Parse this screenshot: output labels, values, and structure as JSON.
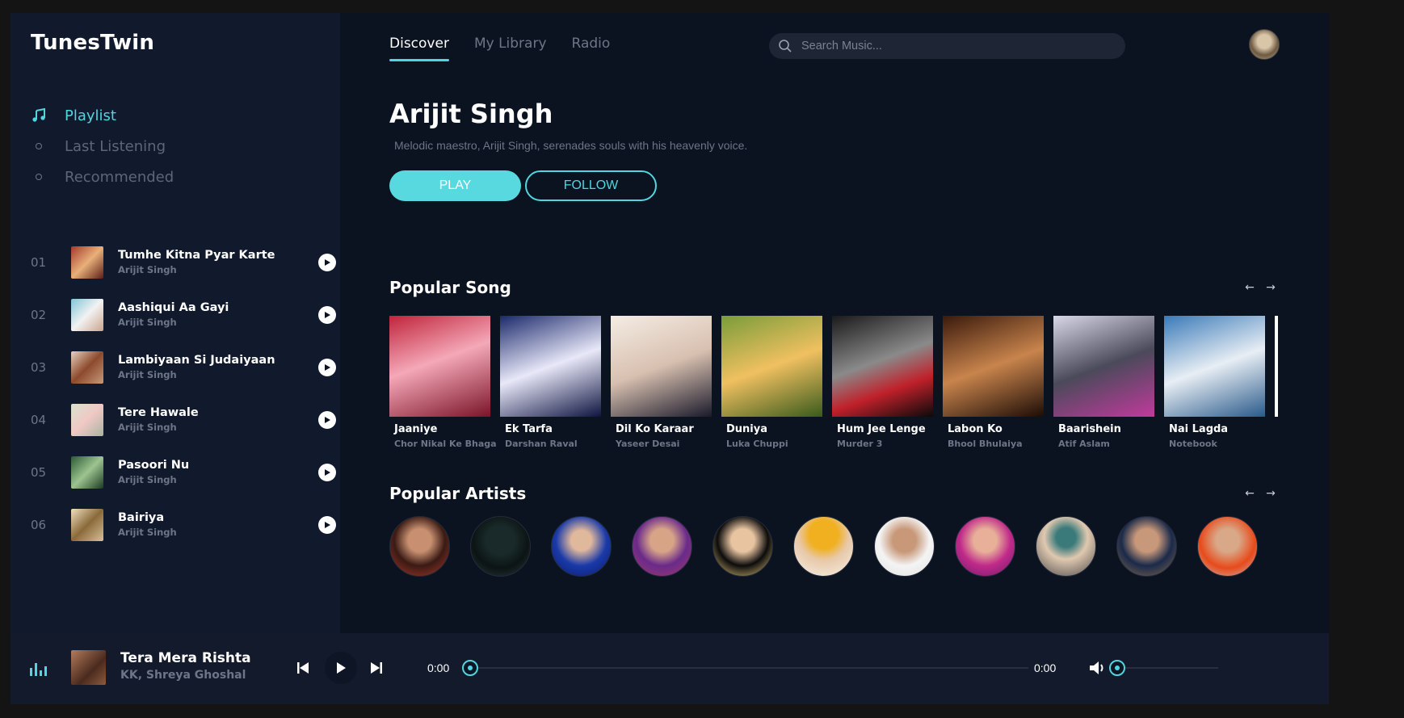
{
  "app": {
    "name": "TunesTwin"
  },
  "sidebar": {
    "nav": [
      {
        "label": "Playlist",
        "icon": "music-note-icon",
        "active": true
      },
      {
        "label": "Last Listening",
        "icon": "circle-bullet-icon",
        "active": false
      },
      {
        "label": "Recommended",
        "icon": "circle-bullet-icon",
        "active": false
      }
    ],
    "playlist": [
      {
        "num": "01",
        "title": "Tumhe Kitna Pyar Karte",
        "artist": "Arijit Singh",
        "thumb": "linear-gradient(135deg,#a4382c,#e8b07a 50%,#5c1e18)"
      },
      {
        "num": "02",
        "title": "Aashiqui Aa Gayi",
        "artist": "Arijit Singh",
        "thumb": "linear-gradient(135deg,#7fc6d8,#f2f2f2 50%,#caa48c)"
      },
      {
        "num": "03",
        "title": "Lambiyaan Si Judaiyaan",
        "artist": "Arijit Singh",
        "thumb": "linear-gradient(135deg,#e8d2c0,#8c4a2c 50%,#c69a7a)"
      },
      {
        "num": "04",
        "title": "Tere Hawale",
        "artist": "Arijit Singh",
        "thumb": "linear-gradient(135deg,#d9e2d0,#f0c8c4 50%,#a8b4a0)"
      },
      {
        "num": "05",
        "title": "Pasoori Nu",
        "artist": "Arijit Singh",
        "thumb": "linear-gradient(135deg,#2e5a34,#9cc490 50%,#1d3a22)"
      },
      {
        "num": "06",
        "title": "Bairiya",
        "artist": "Arijit Singh",
        "thumb": "linear-gradient(135deg,#f0e0c0,#8a6a3a 50%,#d8c098)"
      }
    ]
  },
  "topnav": {
    "tabs": [
      {
        "label": "Discover",
        "active": true
      },
      {
        "label": "My Library",
        "active": false
      },
      {
        "label": "Radio",
        "active": false
      }
    ],
    "search_placeholder": "Search Music..."
  },
  "hero": {
    "title": "Arijit Singh",
    "description": "Melodic maestro, Arijit Singh, serenades souls with his heavenly voice.",
    "play_label": "PLAY",
    "follow_label": "FOLLOW"
  },
  "popular_songs": {
    "title": "Popular Song",
    "items": [
      {
        "title": "Jaaniye",
        "subtitle": "Chor Nikal Ke Bhaga",
        "cover": "linear-gradient(160deg,#c0243a,#f4a8b8 45%,#7a1428)"
      },
      {
        "title": "Ek Tarfa",
        "subtitle": "Darshan Raval",
        "cover": "linear-gradient(160deg,#1c2a6c,#e8e8f8 50%,#0e1440)"
      },
      {
        "title": "Dil Ko Karaar",
        "subtitle": "Yaseer Desai",
        "cover": "linear-gradient(160deg,#f4ede4,#d8c0b0 50%,#1a1a2a)"
      },
      {
        "title": "Duniya",
        "subtitle": "Luka Chuppi",
        "cover": "linear-gradient(160deg,#7a9c3a,#f0c060 50%,#3a5a1c)"
      },
      {
        "title": "Hum Jee Lenge",
        "subtitle": "Murder 3",
        "cover": "linear-gradient(160deg,#1a1a1a,#8a8a8a 45%,#c0202a 70%,#0a0a0a)"
      },
      {
        "title": "Labon Ko",
        "subtitle": "Bhool Bhulaiya",
        "cover": "linear-gradient(160deg,#3a1a0c,#c8844c 50%,#1c0c06)"
      },
      {
        "title": "Baarishein",
        "subtitle": "Atif Aslam",
        "cover": "linear-gradient(160deg,#d8d8e8,#4a4a5a 50%,#c03a9c)"
      },
      {
        "title": "Nai Lagda",
        "subtitle": "Notebook",
        "cover": "linear-gradient(160deg,#3a7ab8,#e8eef4 50%,#2a5a8a)"
      }
    ]
  },
  "popular_artists": {
    "title": "Popular Artists",
    "items": [
      {
        "color": "radial-gradient(circle at 50% 40%,#c89070 0 25%,#3a1a14 55%,#b03a2a 100%)"
      },
      {
        "color": "radial-gradient(circle at 50% 40%,#1a2a2a 0 30%,#0c1414 60%,#2a3a3a 100%)"
      },
      {
        "color": "radial-gradient(circle at 50% 40%,#e0b89c 0 22%,#1a3aa8 55%,#0a1a6a 100%)"
      },
      {
        "color": "radial-gradient(circle at 50% 40%,#d8a488 0 25%,#6a2a8a 55%,#a03a6a 100%)"
      },
      {
        "color": "radial-gradient(circle at 50% 40%,#e8c4a0 0 25%,#0c0c0c 55%,#f0d080 100%)"
      },
      {
        "color": "radial-gradient(circle at 50% 30%,#f0b020 0 28%,#e8c8a8 50%,#f4f0e8 100%)"
      },
      {
        "color": "radial-gradient(circle at 50% 40%,#c89878 0 25%,#f4f4f4 55%,#e0e0e0 100%)"
      },
      {
        "color": "radial-gradient(circle at 50% 40%,#e8b098 0 25%,#c02a8a 55%,#6a1a6a 100%)"
      },
      {
        "color": "radial-gradient(circle at 50% 35%,#3a7a7a 0 20%,#e0c8b0 45%,#4a4a4a 100%)"
      },
      {
        "color": "radial-gradient(circle at 50% 40%,#c8987a 0 25%,#1a2a4a 55%,#8a6a4a 100%)"
      },
      {
        "color": "radial-gradient(circle at 50% 40%,#d8a888 0 25%,#e84a1a 60%,#c0c0c0 100%)"
      }
    ]
  },
  "player": {
    "title": "Tera Mera Rishta",
    "artist": "KK, Shreya Ghoshal",
    "time_current": "0:00",
    "time_total": "0:00",
    "progress": 0,
    "volume": 0
  },
  "colors": {
    "accent": "#4fd6df",
    "background": "#0b1220",
    "sidebar": "#111a2c",
    "muted": "#6d7688"
  }
}
